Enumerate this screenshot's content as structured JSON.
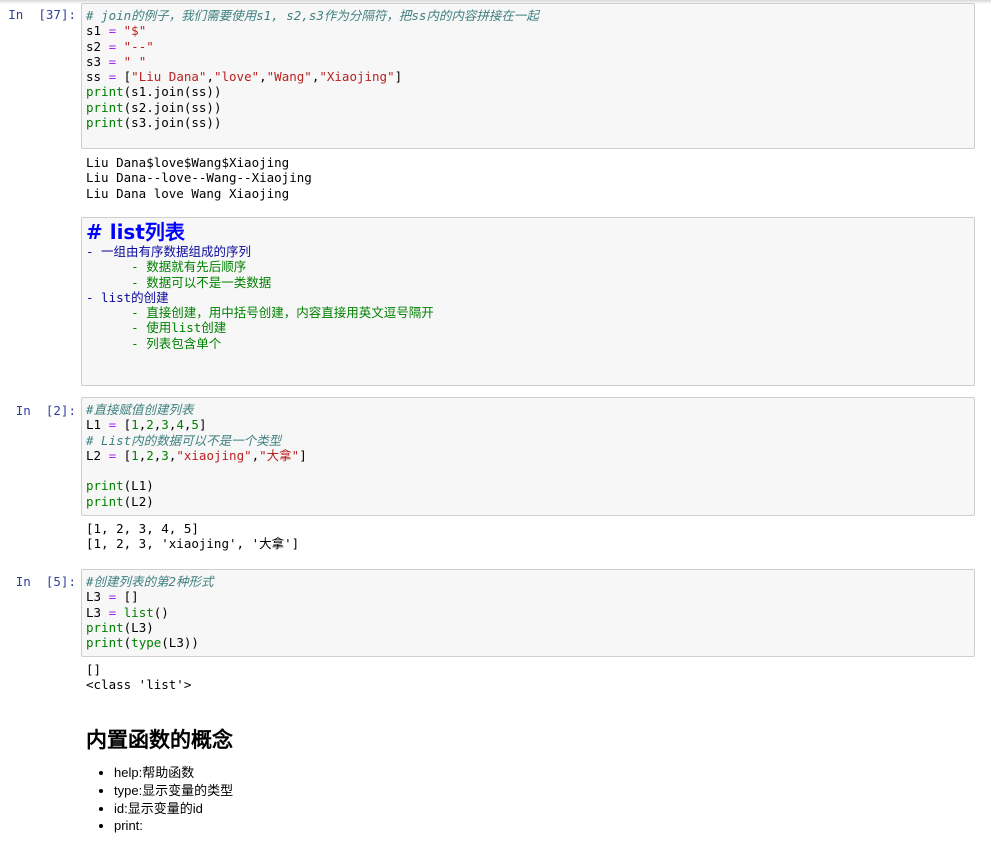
{
  "cells": [
    {
      "prompt": "In  [37]:",
      "code": [
        [
          [
            "cm",
            "# join的例子，我们需要使用s1, s2,s3作为分隔符，把ss内的内容拼接在一起"
          ]
        ],
        [
          [
            "",
            "s1 "
          ],
          [
            "op",
            "="
          ],
          [
            "",
            " "
          ],
          [
            "st",
            "\"$\""
          ]
        ],
        [
          [
            "",
            "s2 "
          ],
          [
            "op",
            "="
          ],
          [
            "",
            " "
          ],
          [
            "st",
            "\"--\""
          ]
        ],
        [
          [
            "",
            "s3 "
          ],
          [
            "op",
            "="
          ],
          [
            "",
            " "
          ],
          [
            "st",
            "\" \""
          ]
        ],
        [
          [
            "",
            "ss "
          ],
          [
            "op",
            "="
          ],
          [
            "",
            " ["
          ],
          [
            "st",
            "\"Liu Dana\""
          ],
          [
            "",
            ","
          ],
          [
            "st",
            "\"love\""
          ],
          [
            "",
            ","
          ],
          [
            "st",
            "\"Wang\""
          ],
          [
            "",
            ","
          ],
          [
            "st",
            "\"Xiaojing\""
          ],
          [
            "",
            "]"
          ]
        ],
        [
          [
            "nb",
            "print"
          ],
          [
            "",
            "(s1.join(ss))"
          ]
        ],
        [
          [
            "nb",
            "print"
          ],
          [
            "",
            "(s2.join(ss))"
          ]
        ],
        [
          [
            "nb",
            "print"
          ],
          [
            "",
            "(s3.join(ss))"
          ]
        ]
      ],
      "output": [
        "Liu Dana$love$Wang$Xiaojing",
        "Liu Dana--love--Wang--Xiaojing",
        "Liu Dana love Wang Xiaojing"
      ]
    },
    {
      "prompt": "In  [2]:",
      "code": [
        [
          [
            "cm",
            "#直接赋值创建列表"
          ]
        ],
        [
          [
            "",
            "L1 "
          ],
          [
            "op",
            "="
          ],
          [
            "",
            " ["
          ],
          [
            "mi",
            "1"
          ],
          [
            "",
            ","
          ],
          [
            "mi",
            "2"
          ],
          [
            "",
            ","
          ],
          [
            "mi",
            "3"
          ],
          [
            "",
            ","
          ],
          [
            "mi",
            "4"
          ],
          [
            "",
            ","
          ],
          [
            "mi",
            "5"
          ],
          [
            "",
            "]"
          ]
        ],
        [
          [
            "cm",
            "# List内的数据可以不是一个类型"
          ]
        ],
        [
          [
            "",
            "L2 "
          ],
          [
            "op",
            "="
          ],
          [
            "",
            " ["
          ],
          [
            "mi",
            "1"
          ],
          [
            "",
            ","
          ],
          [
            "mi",
            "2"
          ],
          [
            "",
            ","
          ],
          [
            "mi",
            "3"
          ],
          [
            "",
            ","
          ],
          [
            "st",
            "\"xiaojing\""
          ],
          [
            "",
            ","
          ],
          [
            "st",
            "\"大拿\""
          ],
          [
            "",
            "]"
          ]
        ],
        [
          [
            "",
            ""
          ]
        ],
        [
          [
            "nb",
            "print"
          ],
          [
            "",
            "(L1)"
          ]
        ],
        [
          [
            "nb",
            "print"
          ],
          [
            "",
            "(L2)"
          ]
        ]
      ],
      "output": [
        "[1, 2, 3, 4, 5]",
        "[1, 2, 3, 'xiaojing', '大拿']"
      ]
    },
    {
      "prompt": "In  [5]:",
      "code": [
        [
          [
            "cm",
            "#创建列表的第2种形式"
          ]
        ],
        [
          [
            "",
            "L3 "
          ],
          [
            "op",
            "="
          ],
          [
            "",
            " []"
          ]
        ],
        [
          [
            "",
            "L3 "
          ],
          [
            "op",
            "="
          ],
          [
            "",
            " "
          ],
          [
            "nb",
            "list"
          ],
          [
            "",
            "()"
          ]
        ],
        [
          [
            "nb",
            "print"
          ],
          [
            "",
            "(L3)"
          ]
        ],
        [
          [
            "nb",
            "print"
          ],
          [
            "",
            "("
          ],
          [
            "nb",
            "type"
          ],
          [
            "",
            "(L3))"
          ]
        ]
      ],
      "output": [
        "[]",
        "<class 'list'>"
      ]
    }
  ],
  "markdown_cell": {
    "heading": "# list列表",
    "lines": [
      {
        "text": "- 一组由有序数据组成的序列",
        "sub": false
      },
      {
        "text": "      - 数据就有先后顺序",
        "sub": true
      },
      {
        "text": "      - 数据可以不是一类数据",
        "sub": true
      },
      {
        "text": "- list的创建",
        "sub": false
      },
      {
        "text": "      - 直接创建，用中括号创建，内容直接用英文逗号隔开",
        "sub": true
      },
      {
        "text": "      - 使用list创建",
        "sub": true
      },
      {
        "text": "      - 列表包含单个",
        "sub": true
      }
    ]
  },
  "rendered_markdown": {
    "heading": "内置函数的概念",
    "items": [
      "help:帮助函数",
      "type:显示变量的类型",
      "id:显示变量的id",
      "print:"
    ]
  }
}
